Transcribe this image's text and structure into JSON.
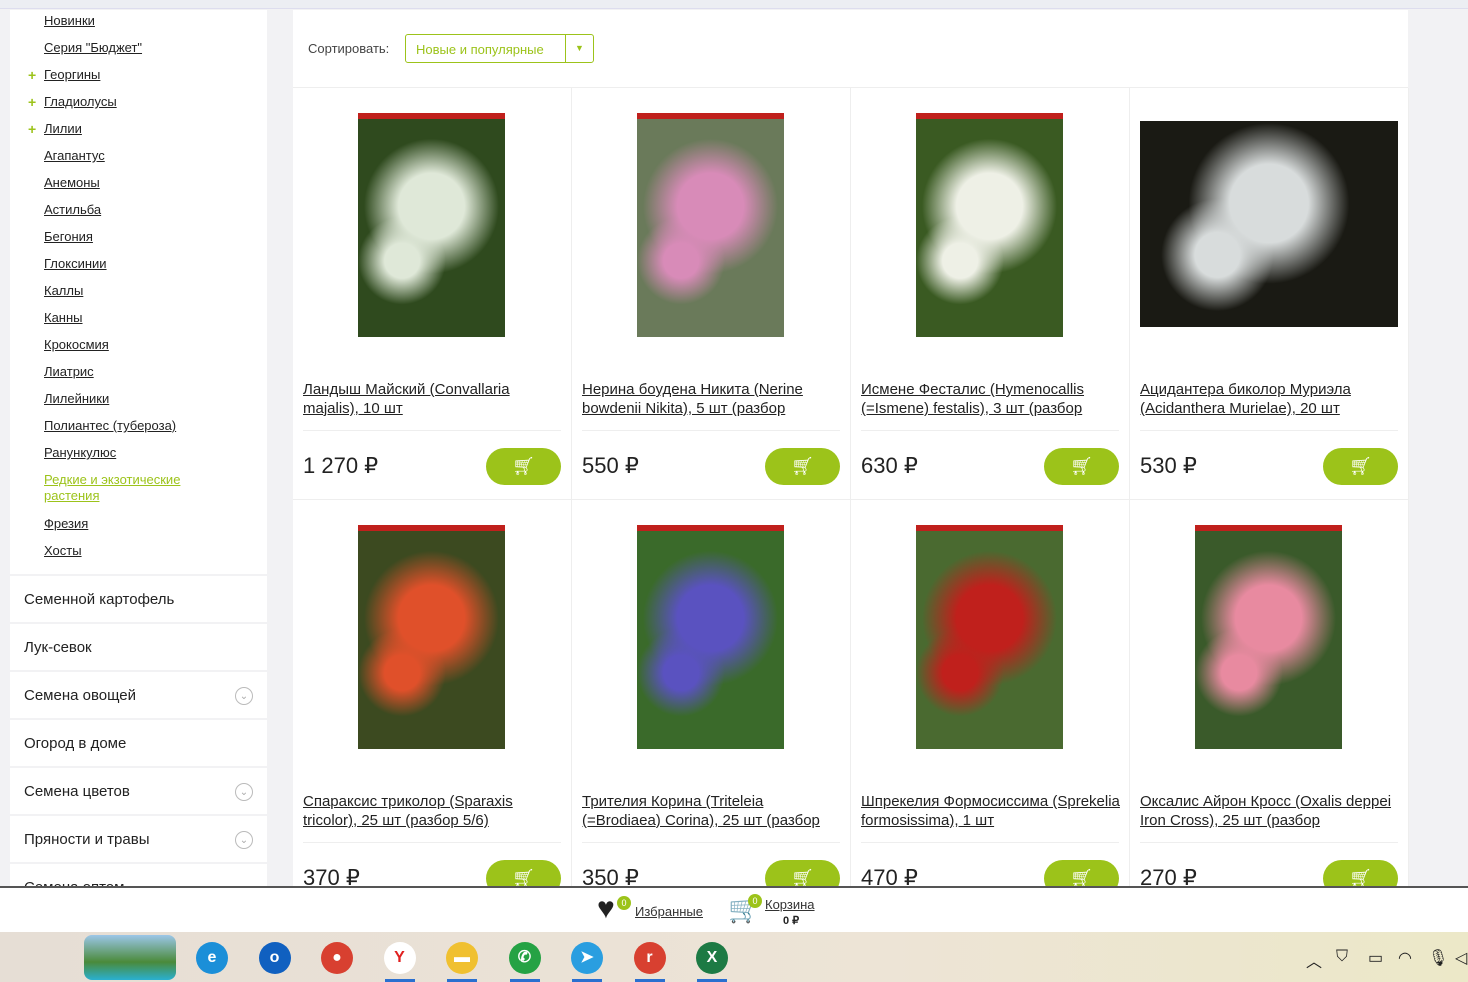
{
  "sidebar": {
    "subitems": [
      {
        "label": "Новинки",
        "plus": false
      },
      {
        "label": "Серия \"Бюджет\"",
        "plus": false
      },
      {
        "label": "Георгины",
        "plus": true
      },
      {
        "label": "Гладиолусы",
        "plus": true
      },
      {
        "label": "Лилии",
        "plus": true
      },
      {
        "label": "Агапантус",
        "plus": false
      },
      {
        "label": "Анемоны",
        "plus": false
      },
      {
        "label": "Астильба",
        "plus": false
      },
      {
        "label": "Бегония",
        "plus": false
      },
      {
        "label": "Глоксинии",
        "plus": false
      },
      {
        "label": "Каллы",
        "plus": false
      },
      {
        "label": "Канны",
        "plus": false
      },
      {
        "label": "Крокосмия",
        "plus": false
      },
      {
        "label": "Лиатрис",
        "plus": false
      },
      {
        "label": "Лилейники",
        "plus": false
      },
      {
        "label": "Полиантес (тубероза)",
        "plus": false
      },
      {
        "label": "Ранункулюс",
        "plus": false
      },
      {
        "label": "Редкие и экзотические растения",
        "plus": false,
        "active": true
      },
      {
        "label": "Фрезия",
        "plus": false
      },
      {
        "label": "Хосты",
        "plus": false
      }
    ],
    "categories": [
      {
        "label": "Семенной картофель",
        "expandable": false
      },
      {
        "label": "Лук-севок",
        "expandable": false
      },
      {
        "label": "Семена овощей",
        "expandable": true
      },
      {
        "label": "Огород в доме",
        "expandable": false
      },
      {
        "label": "Семена цветов",
        "expandable": true
      },
      {
        "label": "Пряности и травы",
        "expandable": true
      },
      {
        "label": "Семена оптом",
        "expandable": false
      }
    ]
  },
  "sort": {
    "label": "Сортировать:",
    "selected": "Новые и популярные"
  },
  "products": [
    {
      "title": "Ландыш Майский (Convallaria majalis), 10 шт",
      "price": "1 270 ₽",
      "colors": [
        "#2f4a1e",
        "#dfe8d8"
      ]
    },
    {
      "title": "Нерина боудена Никита (Nerine bowdenii Nikita), 5 шт (разбор",
      "price": "550 ₽",
      "colors": [
        "#6a7a5a",
        "#d88bb8"
      ]
    },
    {
      "title": "Исмене Фесталис (Hymenocallis (=Ismene) festalis), 3 шт (разбор",
      "price": "630 ₽",
      "colors": [
        "#3a5a22",
        "#eef0e6"
      ]
    },
    {
      "title": "Ацидантера биколор Муриэла (Acidanthera Murielae), 20 шт",
      "price": "530 ₽",
      "colors": [
        "#1a1a14",
        "#d8dcdc"
      ]
    },
    {
      "title": "Спараксис триколор (Sparaxis tricolor), 25 шт (разбор 5/6)",
      "price": "370 ₽",
      "colors": [
        "#3c4a20",
        "#e0502a"
      ]
    },
    {
      "title": "Трителия Корина (Triteleia (=Brodiaea) Corina), 25 шт (разбор",
      "price": "350 ₽",
      "colors": [
        "#3a6a2a",
        "#5a52c0"
      ]
    },
    {
      "title": "Шпрекелия Формосиссима (Sprekelia formosissima), 1 шт",
      "price": "470 ₽",
      "colors": [
        "#4a6a30",
        "#c0201c"
      ]
    },
    {
      "title": "Оксалис Айрон Кросс (Oxalis deppei Iron Cross), 25 шт (разбор",
      "price": "270 ₽",
      "colors": [
        "#3a5a2a",
        "#e88aa0"
      ]
    }
  ],
  "bottom": {
    "favorites_label": "Избранные",
    "favorites_count": "0",
    "cart_label": "Корзина",
    "cart_count": "0",
    "cart_total": "0 ₽"
  },
  "taskbar": {
    "apps": [
      "edge-icon",
      "outlook-icon",
      "chrome-icon",
      "yandex-icon",
      "file-explorer-icon",
      "whatsapp-icon",
      "telegram-icon",
      "chrome-profile-icon",
      "excel-icon"
    ]
  }
}
